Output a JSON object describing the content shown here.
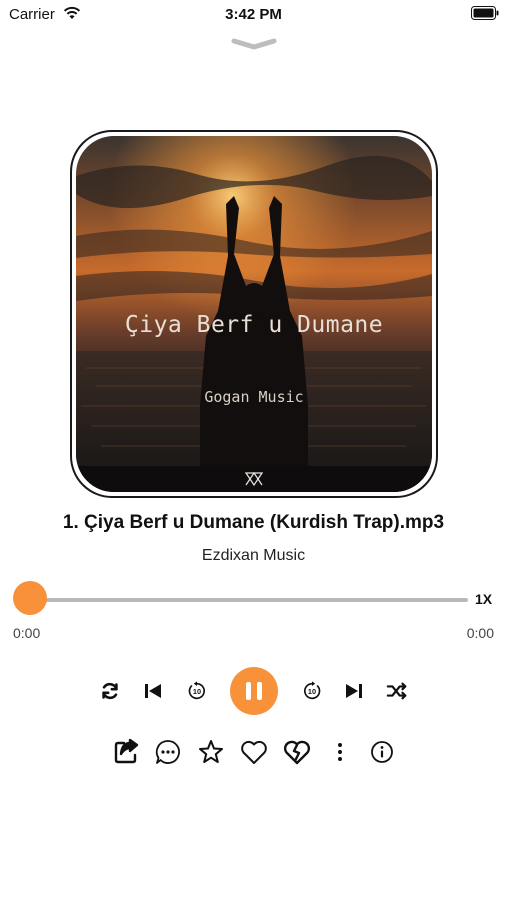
{
  "status": {
    "carrier": "Carrier",
    "time": "3:42 PM"
  },
  "artwork": {
    "title_text": "Çiya Berf u Dumane",
    "subtitle_text": "Gogan Music"
  },
  "track": {
    "title": "1. Çiya Berf u Dumane (Kurdish Trap).mp3",
    "artist": "Ezdixan Music"
  },
  "progress": {
    "elapsed": "0:00",
    "total": "0:00",
    "fraction": 0.0,
    "speed": "1X"
  },
  "controls": [
    "repeat-icon",
    "previous-icon",
    "rewind-10-icon",
    "pause-icon",
    "forward-10-icon",
    "next-icon",
    "shuffle-icon"
  ],
  "actions": [
    "share-icon",
    "comment-icon",
    "star-icon",
    "heart-icon",
    "broken-heart-icon",
    "more-vertical-icon",
    "info-icon"
  ],
  "colors": {
    "accent": "#f7923a",
    "text": "#111111",
    "track": "#b8b8b8"
  }
}
